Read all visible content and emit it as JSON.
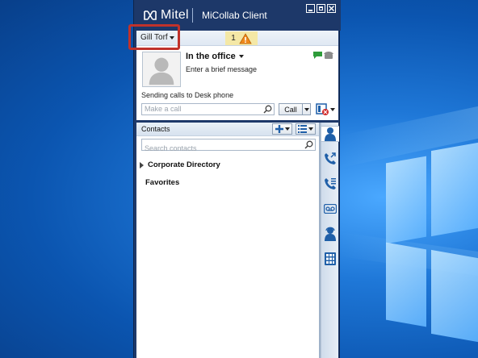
{
  "window": {
    "brand": "Mitel",
    "title": "MiCollab Client"
  },
  "topbar": {
    "user_name": "Gill Torf",
    "alert_count": "1"
  },
  "presence": {
    "status": "In the office",
    "message_placeholder": "Enter a brief message",
    "routing": "Sending calls to Desk phone"
  },
  "dial": {
    "placeholder": "Make a call",
    "call_label": "Call"
  },
  "contacts": {
    "title": "Contacts",
    "search_placeholder": "Search contacts",
    "groups": [
      "Corporate Directory",
      "Favorites"
    ]
  },
  "rail": {
    "icons": [
      "contacts-icon",
      "call-history-icon",
      "call-log-icon",
      "voicemail-icon",
      "agent-icon",
      "dialpad-icon"
    ]
  },
  "colors": {
    "brand_navy": "#1d3869",
    "alert_yellow": "#f4e8a6",
    "highlight_red": "#c0322b",
    "presence_green": "#2e9c3a",
    "rail_blue": "#1f5fa8"
  }
}
